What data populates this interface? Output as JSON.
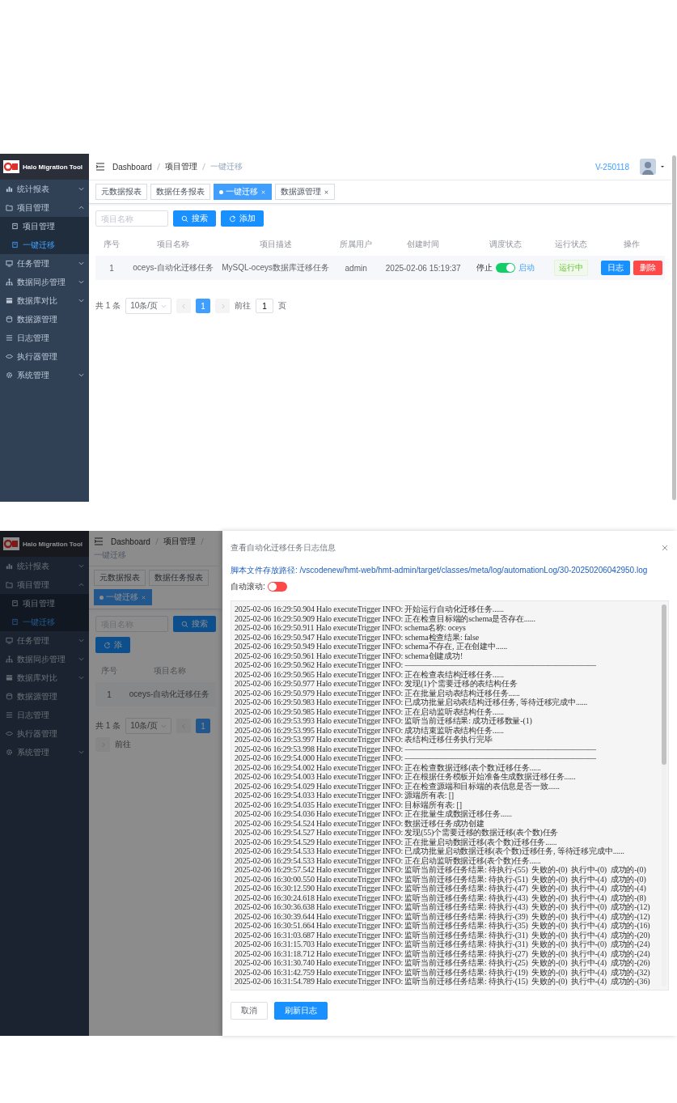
{
  "list_screen": {
    "sidebar": {
      "app_name": "Halo Migration Tool",
      "items": [
        {
          "label": "统计报表",
          "selected": false,
          "expanded": false
        },
        {
          "label": "项目管理",
          "selected": false,
          "expanded": true,
          "children": [
            {
              "label": "项目管理",
              "selected": false
            },
            {
              "label": "一键迁移",
              "selected": true
            }
          ]
        },
        {
          "label": "任务管理",
          "selected": false,
          "expanded": false
        },
        {
          "label": "数据同步管理",
          "selected": false,
          "expanded": false
        },
        {
          "label": "数据库对比",
          "selected": false,
          "expanded": false
        },
        {
          "label": "数据源管理",
          "selected": false
        },
        {
          "label": "日志管理",
          "selected": false
        },
        {
          "label": "执行器管理",
          "selected": false
        },
        {
          "label": "系统管理",
          "selected": false,
          "expanded": false
        }
      ]
    },
    "header": {
      "breadcrumb": [
        "Dashboard",
        "项目管理",
        "一键迁移"
      ],
      "version": "V-250118"
    },
    "tabs": [
      {
        "label": "元数据报表",
        "selected": false,
        "closable": false
      },
      {
        "label": "数据任务报表",
        "selected": false,
        "closable": false
      },
      {
        "label": "一键迁移",
        "selected": true,
        "closable": true
      },
      {
        "label": "数据源管理",
        "selected": false,
        "closable": true
      }
    ],
    "search": {
      "placeholder": "项目名称"
    },
    "buttons": [
      {
        "label": "搜索",
        "kind": "search"
      },
      {
        "label": "添加",
        "kind": "add"
      }
    ],
    "table": {
      "columns": [
        "序号",
        "项目名称",
        "项目描述",
        "所属用户",
        "创建时间",
        "调度状态",
        "运行状态",
        "操作"
      ],
      "rows": [
        {
          "index": "1",
          "name": "oceys-自动化迁移任务",
          "description": "MySQL-oceys数据库迁移任务",
          "user": "admin",
          "created": "2025-02-06 15:19:37",
          "schedule": {
            "off_label": "停止",
            "on": true,
            "on_label": "启动"
          },
          "status": {
            "label": "运行中",
            "kind": "success"
          },
          "actions": [
            {
              "label": "日志",
              "kind": "primary"
            },
            {
              "label": "删除",
              "kind": "danger"
            }
          ]
        }
      ]
    },
    "pagination": {
      "total": "共 1 条",
      "page_size": "10条/页",
      "pages": [
        {
          "label": "1",
          "selected": true
        }
      ],
      "goto_label": "前往",
      "goto_value": "1",
      "goto_suffix": "页"
    }
  },
  "log_screen": {
    "sidebar": {
      "app_name": "Halo Migration Tool",
      "items": [
        {
          "label": "统计报表",
          "selected": false,
          "expanded": false
        },
        {
          "label": "项目管理",
          "selected": false,
          "expanded": true,
          "children": [
            {
              "label": "项目管理",
              "selected": false
            },
            {
              "label": "一键迁移",
              "selected": true
            }
          ]
        },
        {
          "label": "任务管理",
          "selected": false,
          "expanded": false
        },
        {
          "label": "数据同步管理",
          "selected": false,
          "expanded": false
        },
        {
          "label": "数据库对比",
          "selected": false,
          "expanded": false
        },
        {
          "label": "数据源管理",
          "selected": false
        },
        {
          "label": "日志管理",
          "selected": false
        },
        {
          "label": "执行器管理",
          "selected": false
        },
        {
          "label": "系统管理",
          "selected": false,
          "expanded": false
        }
      ]
    },
    "background": {
      "breadcrumb": [
        "Dashboard",
        "项目管理",
        "一键迁移"
      ],
      "tabs": [
        {
          "label": "元数据报表",
          "selected": false,
          "closable": false
        },
        {
          "label": "数据任务报表",
          "selected": false,
          "closable": false
        },
        {
          "label": "一键迁移",
          "selected": true,
          "closable": true
        }
      ],
      "search": {
        "placeholder": "项目名称"
      },
      "buttons": [
        {
          "label": "搜索",
          "kind": "search"
        },
        {
          "label": "添",
          "kind": "add"
        }
      ],
      "columns": [
        "序号",
        "项目名称"
      ],
      "row": [
        "1",
        "oceys-自动化迁移任务"
      ],
      "pagination": {
        "total": "共 1 条",
        "page_size": "10条/页",
        "pages": [
          {
            "label": "1",
            "selected": true
          }
        ],
        "goto_label": "前往"
      }
    },
    "drawer": {
      "title": "查看自动化迁移任务日志信息",
      "path": "脚本文件存放路径: /vscodenew/hmt-web/hmt-admin/target/classes/meta/log/automationLog/30-20250206042950.log",
      "auto_scroll": {
        "label": "自动滚动:",
        "on": false
      },
      "log_lines": [
        "2025-02-06 16:29:50.904 Halo executeTrigger INFO: 开始运行自动化迁移任务......",
        "2025-02-06 16:29:50.909 Halo executeTrigger INFO: 正在检查目标端的schema是否存在......",
        "2025-02-06 16:29:50.911 Halo executeTrigger INFO: schema名称: oceys",
        "2025-02-06 16:29:50.947 Halo executeTrigger INFO: schema检查结果: false",
        "2025-02-06 16:29:50.949 Halo executeTrigger INFO: schema不存在, 正在创建中......",
        "2025-02-06 16:29:50.961 Halo executeTrigger INFO: schema创建成功!",
        "2025-02-06 16:29:50.962 Halo executeTrigger INFO: ————————————————————————",
        "2025-02-06 16:29:50.965 Halo executeTrigger INFO: 正在检查表结构迁移任务......",
        "2025-02-06 16:29:50.977 Halo executeTrigger INFO: 发现(1)个需要迁移的表结构任务",
        "2025-02-06 16:29:50.979 Halo executeTrigger INFO: 正在批量启动表结构迁移任务......",
        "2025-02-06 16:29:50.983 Halo executeTrigger INFO: 已成功批量启动表结构迁移任务, 等待迁移完成中......",
        "2025-02-06 16:29:50.985 Halo executeTrigger INFO: 正在启动监听表结构任务......",
        "2025-02-06 16:29:53.993 Halo executeTrigger INFO: 监听当前迁移结果: 成功迁移数量-(1)",
        "2025-02-06 16:29:53.995 Halo executeTrigger INFO: 成功结束监听表结构任务......",
        "2025-02-06 16:29:53.997 Halo executeTrigger INFO: 表结构迁移任务执行完毕",
        "2025-02-06 16:29:53.998 Halo executeTrigger INFO: ————————————————————————",
        "2025-02-06 16:29:54.000 Halo executeTrigger INFO: ————————————————————————",
        "2025-02-06 16:29:54.002 Halo executeTrigger INFO: 正在检查数据迁移(表个数)迁移任务......",
        "2025-02-06 16:29:54.003 Halo executeTrigger INFO: 正在根据任务模板开始准备生成数据迁移任务......",
        "2025-02-06 16:29:54.029 Halo executeTrigger INFO: 正在检查源端和目标端的表信息是否一致......",
        "2025-02-06 16:29:54.033 Halo executeTrigger INFO: 源端所有表: []",
        "2025-02-06 16:29:54.035 Halo executeTrigger INFO: 目标端所有表: []",
        "2025-02-06 16:29:54.036 Halo executeTrigger INFO: 正在批量生成数据迁移任务......",
        "2025-02-06 16:29:54.524 Halo executeTrigger INFO: 数据迁移任务成功创建",
        "2025-02-06 16:29:54.527 Halo executeTrigger INFO: 发现(55)个需要迁移的数据迁移(表个数)任务",
        "2025-02-06 16:29:54.529 Halo executeTrigger INFO: 正在批量启动数据迁移(表个数)迁移任务......",
        "2025-02-06 16:29:54.533 Halo executeTrigger INFO: 已成功批量启动数据迁移(表个数)迁移任务, 等待迁移完成中......",
        "2025-02-06 16:29:54.533 Halo executeTrigger INFO: 正在启动监听数据迁移(表个数)任务......",
        "2025-02-06 16:29:57.542 Halo executeTrigger INFO: 监听当前迁移任务结果: 待执行-(55)  失败的-(0)  执行中-(0)  成功的-(0)",
        "2025-02-06 16:30:00.550 Halo executeTrigger INFO: 监听当前迁移任务结果: 待执行-(51)  失败的-(0)  执行中-(4)  成功的-(0)",
        "2025-02-06 16:30:12.590 Halo executeTrigger INFO: 监听当前迁移任务结果: 待执行-(47)  失败的-(0)  执行中-(4)  成功的-(4)",
        "2025-02-06 16:30:24.618 Halo executeTrigger INFO: 监听当前迁移任务结果: 待执行-(43)  失败的-(0)  执行中-(4)  成功的-(8)",
        "2025-02-06 16:30:36.638 Halo executeTrigger INFO: 监听当前迁移任务结果: 待执行-(43)  失败的-(0)  执行中-(0)  成功的-(12)",
        "2025-02-06 16:30:39.644 Halo executeTrigger INFO: 监听当前迁移任务结果: 待执行-(39)  失败的-(0)  执行中-(4)  成功的-(12)",
        "2025-02-06 16:30:51.664 Halo executeTrigger INFO: 监听当前迁移任务结果: 待执行-(35)  失败的-(0)  执行中-(4)  成功的-(16)",
        "2025-02-06 16:31:03.687 Halo executeTrigger INFO: 监听当前迁移任务结果: 待执行-(31)  失败的-(0)  执行中-(4)  成功的-(20)",
        "2025-02-06 16:31:15.703 Halo executeTrigger INFO: 监听当前迁移任务结果: 待执行-(31)  失败的-(0)  执行中-(0)  成功的-(24)",
        "2025-02-06 16:31:18.712 Halo executeTrigger INFO: 监听当前迁移任务结果: 待执行-(27)  失败的-(0)  执行中-(4)  成功的-(24)",
        "2025-02-06 16:31:30.740 Halo executeTrigger INFO: 监听当前迁移任务结果: 待执行-(25)  失败的-(0)  执行中-(4)  成功的-(26)",
        "2025-02-06 16:31:42.759 Halo executeTrigger INFO: 监听当前迁移任务结果: 待执行-(19)  失败的-(0)  执行中-(4)  成功的-(32)",
        "2025-02-06 16:31:54.789 Halo executeTrigger INFO: 监听当前迁移任务结果: 待执行-(15)  失败的-(0)  执行中-(4)  成功的-(36)"
      ],
      "buttons": [
        {
          "label": "取消",
          "kind": "default"
        },
        {
          "label": "刷新日志",
          "kind": "primary"
        }
      ]
    }
  }
}
